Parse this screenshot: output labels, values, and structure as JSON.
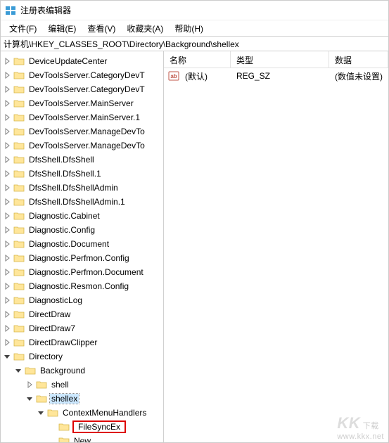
{
  "window": {
    "title": "注册表编辑器"
  },
  "menubar": {
    "file": "文件(F)",
    "edit": "编辑(E)",
    "view": "查看(V)",
    "favorites": "收藏夹(A)",
    "help": "帮助(H)"
  },
  "addressbar": {
    "path": "计算机\\HKEY_CLASSES_ROOT\\Directory\\Background\\shellex"
  },
  "tree": {
    "items": [
      {
        "label": "DeviceUpdateCenter",
        "depth": 0,
        "expander": "closed"
      },
      {
        "label": "DevToolsServer.CategoryDevT",
        "depth": 0,
        "expander": "closed"
      },
      {
        "label": "DevToolsServer.CategoryDevT",
        "depth": 0,
        "expander": "closed"
      },
      {
        "label": "DevToolsServer.MainServer",
        "depth": 0,
        "expander": "closed"
      },
      {
        "label": "DevToolsServer.MainServer.1",
        "depth": 0,
        "expander": "closed"
      },
      {
        "label": "DevToolsServer.ManageDevTo",
        "depth": 0,
        "expander": "closed"
      },
      {
        "label": "DevToolsServer.ManageDevTo",
        "depth": 0,
        "expander": "closed"
      },
      {
        "label": "DfsShell.DfsShell",
        "depth": 0,
        "expander": "closed"
      },
      {
        "label": "DfsShell.DfsShell.1",
        "depth": 0,
        "expander": "closed"
      },
      {
        "label": "DfsShell.DfsShellAdmin",
        "depth": 0,
        "expander": "closed"
      },
      {
        "label": "DfsShell.DfsShellAdmin.1",
        "depth": 0,
        "expander": "closed"
      },
      {
        "label": "Diagnostic.Cabinet",
        "depth": 0,
        "expander": "closed"
      },
      {
        "label": "Diagnostic.Config",
        "depth": 0,
        "expander": "closed"
      },
      {
        "label": "Diagnostic.Document",
        "depth": 0,
        "expander": "closed"
      },
      {
        "label": "Diagnostic.Perfmon.Config",
        "depth": 0,
        "expander": "closed"
      },
      {
        "label": "Diagnostic.Perfmon.Document",
        "depth": 0,
        "expander": "closed"
      },
      {
        "label": "Diagnostic.Resmon.Config",
        "depth": 0,
        "expander": "closed"
      },
      {
        "label": "DiagnosticLog",
        "depth": 0,
        "expander": "closed"
      },
      {
        "label": "DirectDraw",
        "depth": 0,
        "expander": "closed"
      },
      {
        "label": "DirectDraw7",
        "depth": 0,
        "expander": "closed"
      },
      {
        "label": "DirectDrawClipper",
        "depth": 0,
        "expander": "closed"
      },
      {
        "label": "Directory",
        "depth": 0,
        "expander": "open"
      },
      {
        "label": "Background",
        "depth": 1,
        "expander": "open"
      },
      {
        "label": "shell",
        "depth": 2,
        "expander": "closed"
      },
      {
        "label": "shellex",
        "depth": 2,
        "expander": "open",
        "selected": true
      },
      {
        "label": "ContextMenuHandlers",
        "depth": 3,
        "expander": "open"
      },
      {
        "label": "FileSyncEx",
        "depth": 4,
        "expander": "none",
        "highlighted": true
      },
      {
        "label": "New",
        "depth": 4,
        "expander": "none"
      }
    ]
  },
  "list": {
    "columns": {
      "name": "名称",
      "type": "类型",
      "data": "数据"
    },
    "rows": [
      {
        "name": "(默认)",
        "type": "REG_SZ",
        "data": "(数值未设置)"
      }
    ]
  },
  "watermark": {
    "logo": "KK",
    "sub": "下载",
    "url": "www.kkx.net"
  }
}
